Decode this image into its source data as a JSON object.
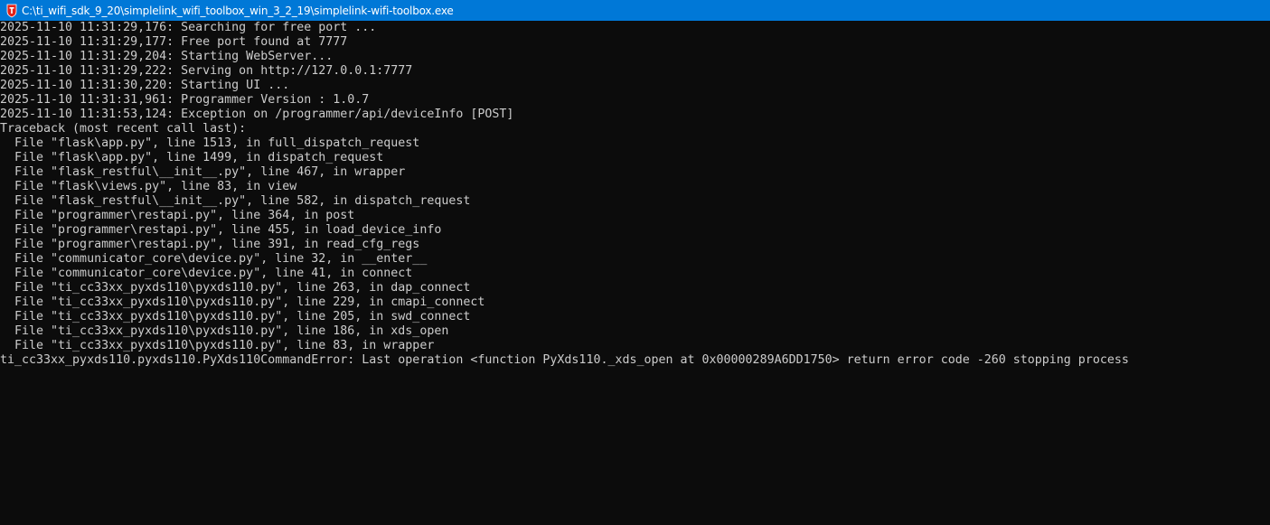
{
  "window": {
    "title": "C:\\ti_wifi_sdk_9_20\\simplelink_wifi_toolbox_win_3_2_19\\simplelink-wifi-toolbox.exe",
    "icon": "ti-logo-icon",
    "titlebar_color": "#0078d7",
    "background_color": "#0c0c0c",
    "text_color": "#cccccc"
  },
  "console": {
    "lines": [
      "2025-11-10 11:31:29,176: Searching for free port ...",
      "2025-11-10 11:31:29,177: Free port found at 7777",
      "2025-11-10 11:31:29,204: Starting WebServer...",
      "2025-11-10 11:31:29,222: Serving on http://127.0.0.1:7777",
      "2025-11-10 11:31:30,220: Starting UI ...",
      "2025-11-10 11:31:31,961: Programmer Version : 1.0.7",
      "2025-11-10 11:31:53,124: Exception on /programmer/api/deviceInfo [POST]",
      "Traceback (most recent call last):",
      "  File \"flask\\app.py\", line 1513, in full_dispatch_request",
      "  File \"flask\\app.py\", line 1499, in dispatch_request",
      "  File \"flask_restful\\__init__.py\", line 467, in wrapper",
      "  File \"flask\\views.py\", line 83, in view",
      "  File \"flask_restful\\__init__.py\", line 582, in dispatch_request",
      "  File \"programmer\\restapi.py\", line 364, in post",
      "  File \"programmer\\restapi.py\", line 455, in load_device_info",
      "  File \"programmer\\restapi.py\", line 391, in read_cfg_regs",
      "  File \"communicator_core\\device.py\", line 32, in __enter__",
      "  File \"communicator_core\\device.py\", line 41, in connect",
      "  File \"ti_cc33xx_pyxds110\\pyxds110.py\", line 263, in dap_connect",
      "  File \"ti_cc33xx_pyxds110\\pyxds110.py\", line 229, in cmapi_connect",
      "  File \"ti_cc33xx_pyxds110\\pyxds110.py\", line 205, in swd_connect",
      "  File \"ti_cc33xx_pyxds110\\pyxds110.py\", line 186, in xds_open",
      "  File \"ti_cc33xx_pyxds110\\pyxds110.py\", line 83, in wrapper",
      "ti_cc33xx_pyxds110.pyxds110.PyXds110CommandError: Last operation <function PyXds110._xds_open at 0x00000289A6DD1750> return error code -260 stopping process"
    ]
  }
}
